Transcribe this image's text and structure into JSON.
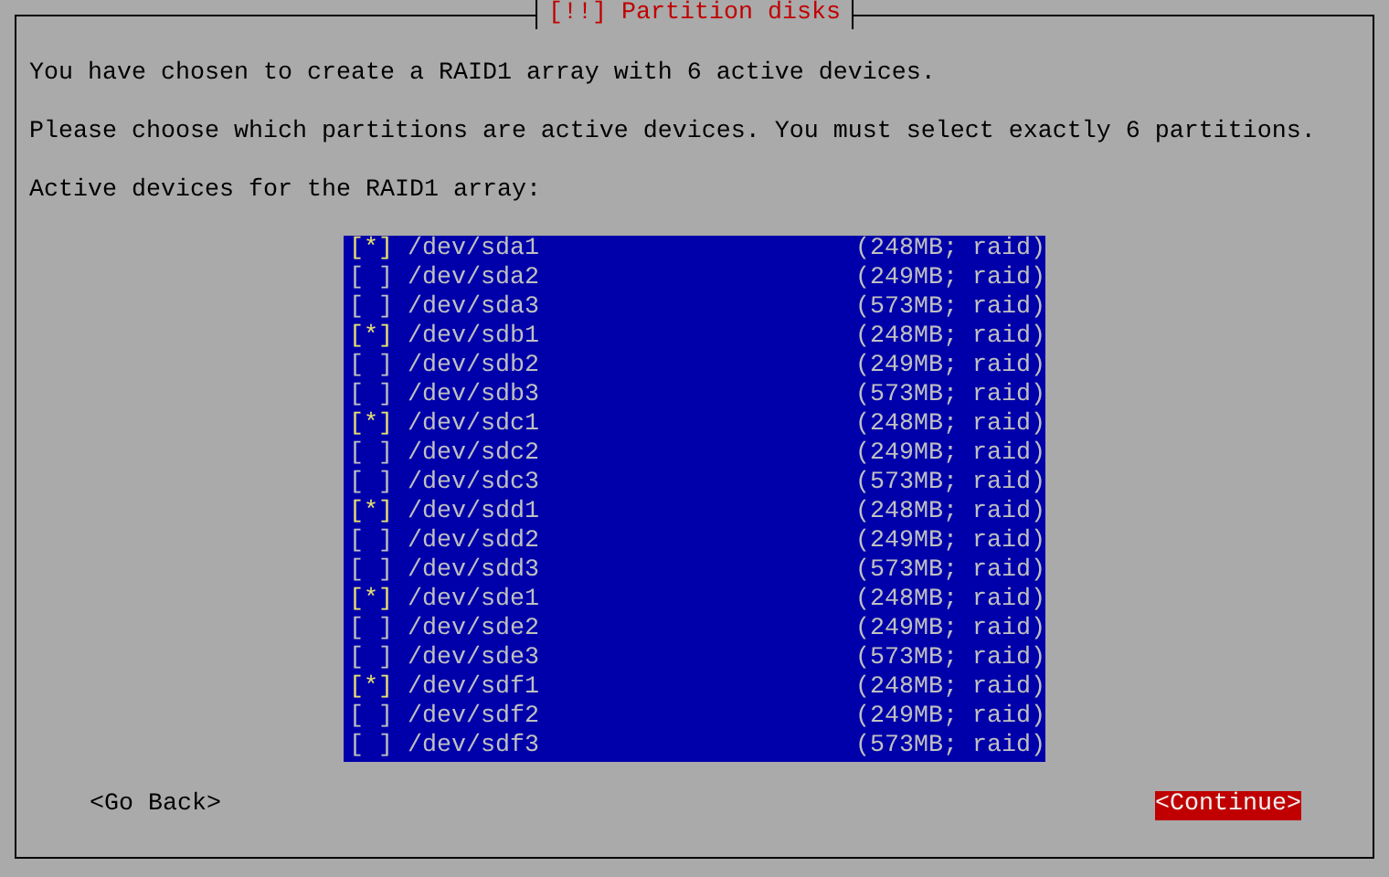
{
  "dialog": {
    "title": "[!!] Partition disks",
    "paragraphs": [
      "You have chosen to create a RAID1 array with 6 active devices.",
      "Please choose which partitions are active devices. You must select exactly 6 partitions.",
      "Active devices for the RAID1 array:"
    ],
    "devices": [
      {
        "mark": "[*]",
        "name": "/dev/sda1",
        "info": "(248MB; raid)",
        "checked": true
      },
      {
        "mark": "[ ]",
        "name": "/dev/sda2",
        "info": "(249MB; raid)",
        "checked": false
      },
      {
        "mark": "[ ]",
        "name": "/dev/sda3",
        "info": "(573MB; raid)",
        "checked": false
      },
      {
        "mark": "[*]",
        "name": "/dev/sdb1",
        "info": "(248MB; raid)",
        "checked": true
      },
      {
        "mark": "[ ]",
        "name": "/dev/sdb2",
        "info": "(249MB; raid)",
        "checked": false
      },
      {
        "mark": "[ ]",
        "name": "/dev/sdb3",
        "info": "(573MB; raid)",
        "checked": false
      },
      {
        "mark": "[*]",
        "name": "/dev/sdc1",
        "info": "(248MB; raid)",
        "checked": true
      },
      {
        "mark": "[ ]",
        "name": "/dev/sdc2",
        "info": "(249MB; raid)",
        "checked": false
      },
      {
        "mark": "[ ]",
        "name": "/dev/sdc3",
        "info": "(573MB; raid)",
        "checked": false
      },
      {
        "mark": "[*]",
        "name": "/dev/sdd1",
        "info": "(248MB; raid)",
        "checked": true
      },
      {
        "mark": "[ ]",
        "name": "/dev/sdd2",
        "info": "(249MB; raid)",
        "checked": false
      },
      {
        "mark": "[ ]",
        "name": "/dev/sdd3",
        "info": "(573MB; raid)",
        "checked": false
      },
      {
        "mark": "[*]",
        "name": "/dev/sde1",
        "info": "(248MB; raid)",
        "checked": true
      },
      {
        "mark": "[ ]",
        "name": "/dev/sde2",
        "info": "(249MB; raid)",
        "checked": false
      },
      {
        "mark": "[ ]",
        "name": "/dev/sde3",
        "info": "(573MB; raid)",
        "checked": false
      },
      {
        "mark": "[*]",
        "name": "/dev/sdf1",
        "info": "(248MB; raid)",
        "checked": true
      },
      {
        "mark": "[ ]",
        "name": "/dev/sdf2",
        "info": "(249MB; raid)",
        "checked": false
      },
      {
        "mark": "[ ]",
        "name": "/dev/sdf3",
        "info": "(573MB; raid)",
        "checked": false
      }
    ],
    "buttons": [
      {
        "label": "<Go Back>",
        "selected": false
      },
      {
        "label": "<Continue>",
        "selected": true
      }
    ]
  }
}
